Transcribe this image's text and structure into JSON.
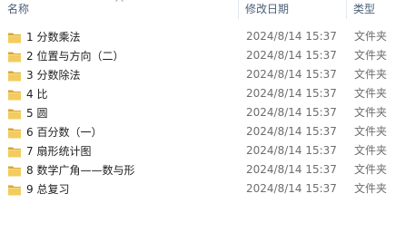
{
  "columns": {
    "name": "名称",
    "modified": "修改日期",
    "type": "类型"
  },
  "rows": [
    {
      "name": "1 分数乘法",
      "modified": "2024/8/14 15:37",
      "type": "文件夹"
    },
    {
      "name": "2 位置与方向（二）",
      "modified": "2024/8/14 15:37",
      "type": "文件夹"
    },
    {
      "name": "3 分数除法",
      "modified": "2024/8/14 15:37",
      "type": "文件夹"
    },
    {
      "name": "4 比",
      "modified": "2024/8/14 15:37",
      "type": "文件夹"
    },
    {
      "name": "5 圆",
      "modified": "2024/8/14 15:37",
      "type": "文件夹"
    },
    {
      "name": "6 百分数（一）",
      "modified": "2024/8/14 15:37",
      "type": "文件夹"
    },
    {
      "name": "7 扇形统计图",
      "modified": "2024/8/14 15:37",
      "type": "文件夹"
    },
    {
      "name": "8 数学广角——数与形",
      "modified": "2024/8/14 15:37",
      "type": "文件夹"
    },
    {
      "name": "9 总复习",
      "modified": "2024/8/14 15:37",
      "type": "文件夹"
    }
  ],
  "icons": {
    "row_icon": "folder-icon",
    "sort": "sort-ascending-icon"
  },
  "colors": {
    "folder": "#e9be4a",
    "header_text": "#4c607a",
    "secondary_text": "#6d6d6d"
  }
}
